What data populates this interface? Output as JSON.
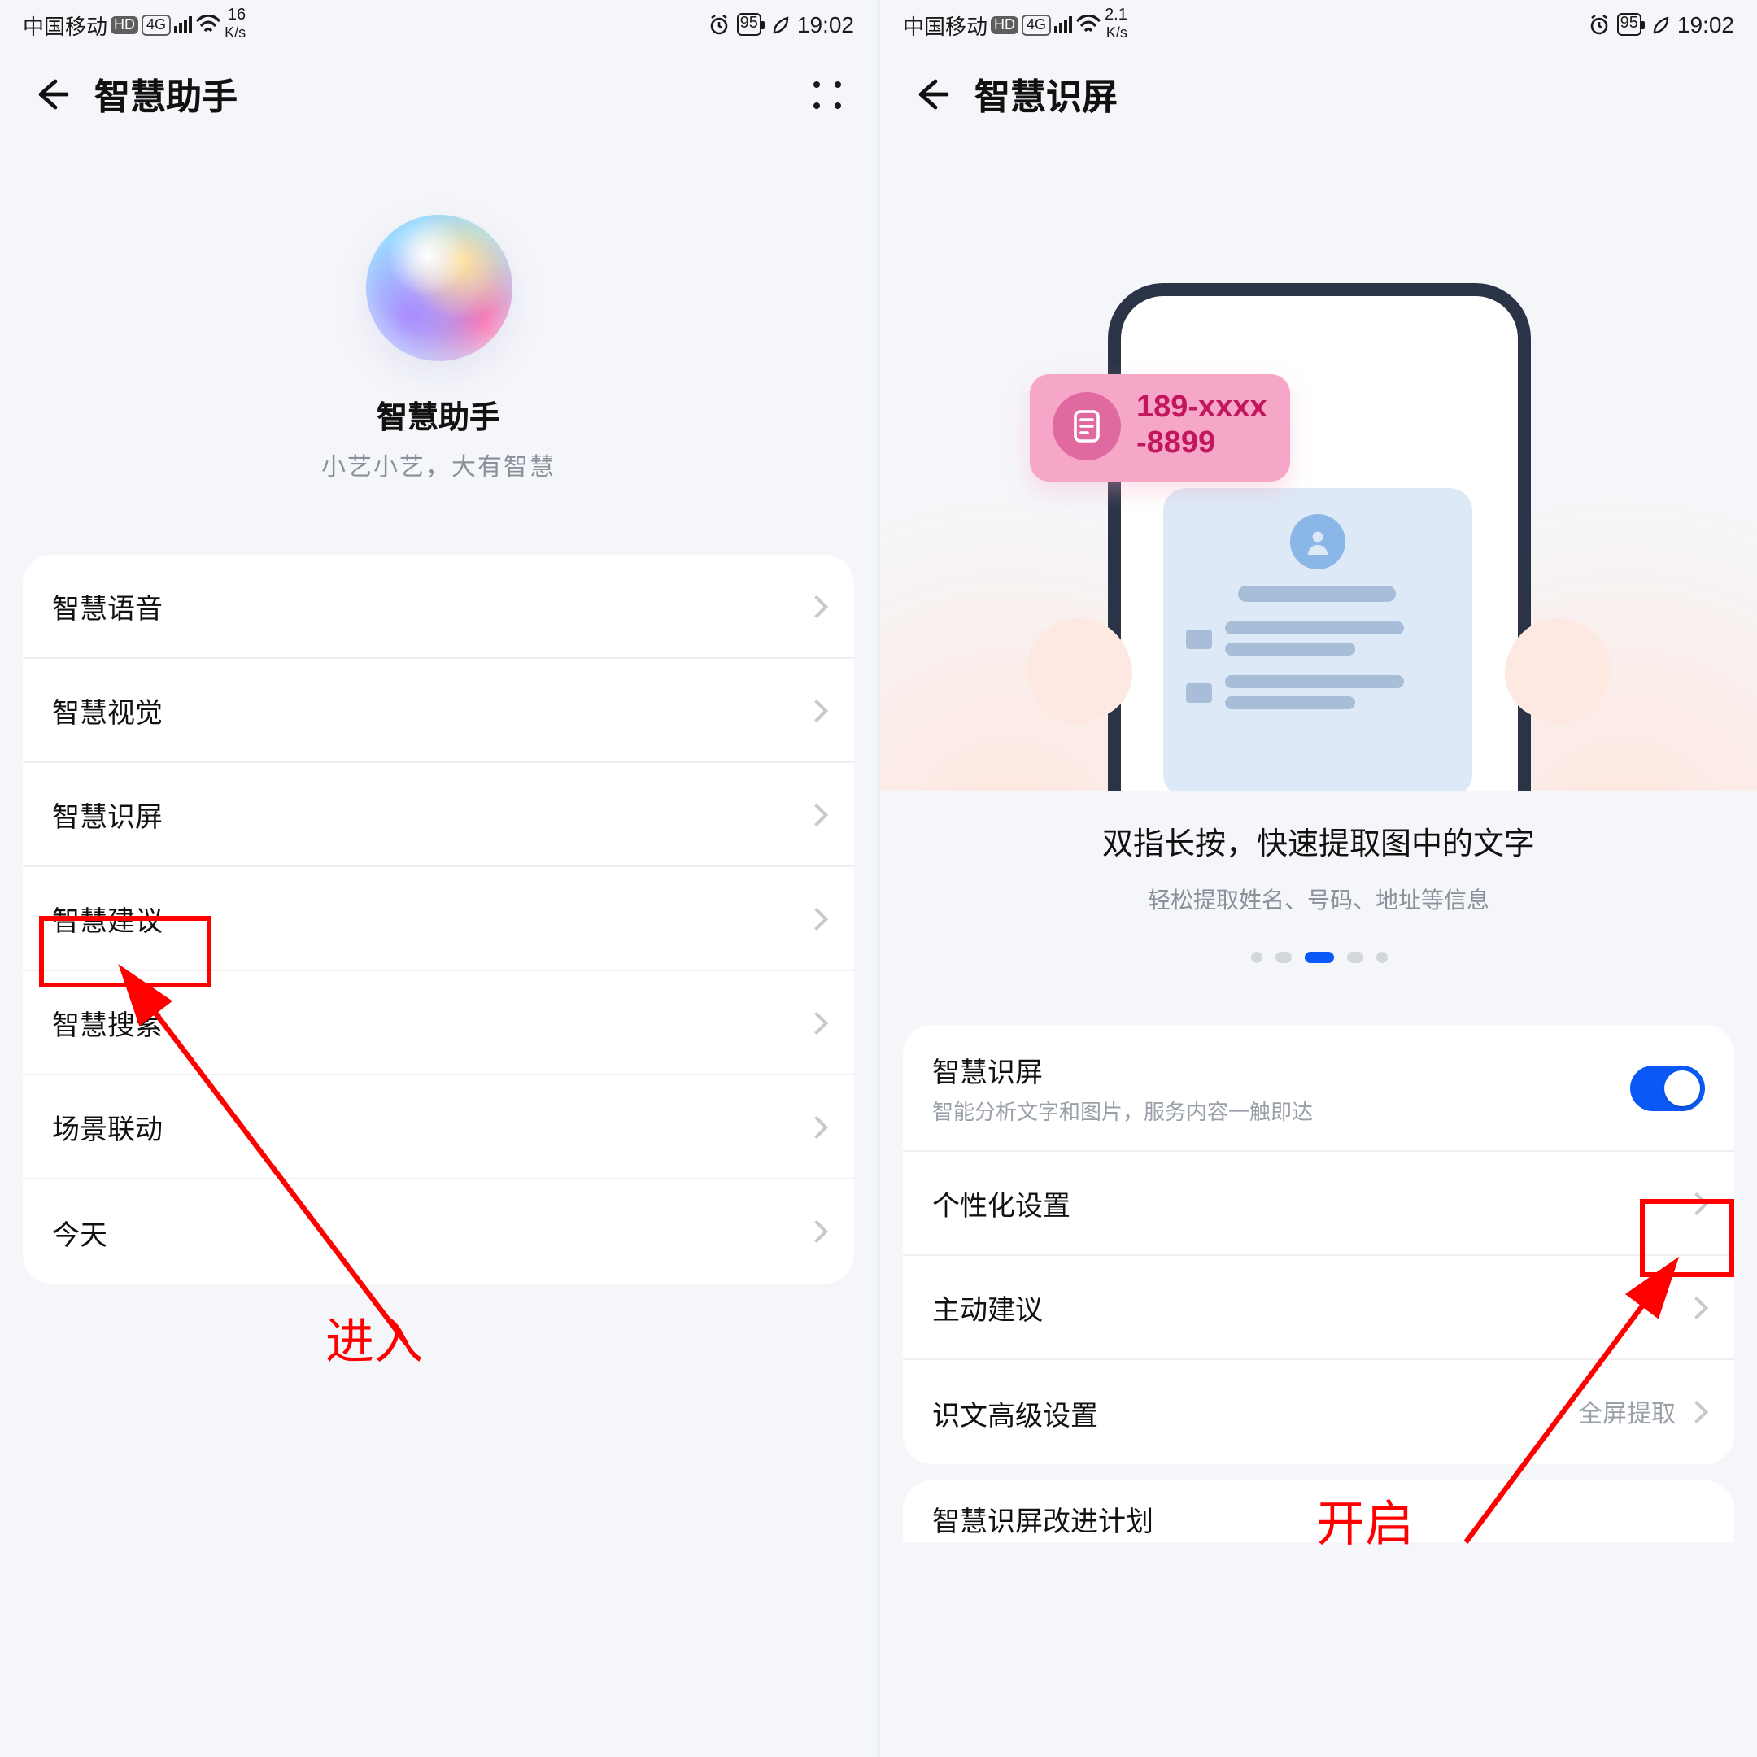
{
  "status": {
    "carrier": "中国移动",
    "hd": "HD",
    "net": "4G",
    "clock": "19:02",
    "battery": "95",
    "kps_left": "16",
    "kps_right": "2.1",
    "kps_unit": "K/s"
  },
  "screen1": {
    "title": "智慧助手",
    "hero_title": "智慧助手",
    "hero_sub": "小艺小艺，大有智慧",
    "items": [
      "智慧语音",
      "智慧视觉",
      "智慧识屏",
      "智慧建议",
      "智慧搜索",
      "场景联动",
      "今天"
    ],
    "anno": "进入"
  },
  "screen2": {
    "title": "智慧识屏",
    "bubble_line1": "189-xxxx",
    "bubble_line2": "-8899",
    "caption1": "双指长按，快速提取图中的文字",
    "caption2": "轻松提取姓名、号码、地址等信息",
    "toggle": {
      "title": "智慧识屏",
      "sub": "智能分析文字和图片，服务内容一触即达"
    },
    "items": {
      "personal": "个性化设置",
      "suggest": "主动建议",
      "advanced": "识文高级设置",
      "advanced_value": "全屏提取",
      "improve": "智慧识屏改进计划"
    },
    "anno": "开启"
  }
}
